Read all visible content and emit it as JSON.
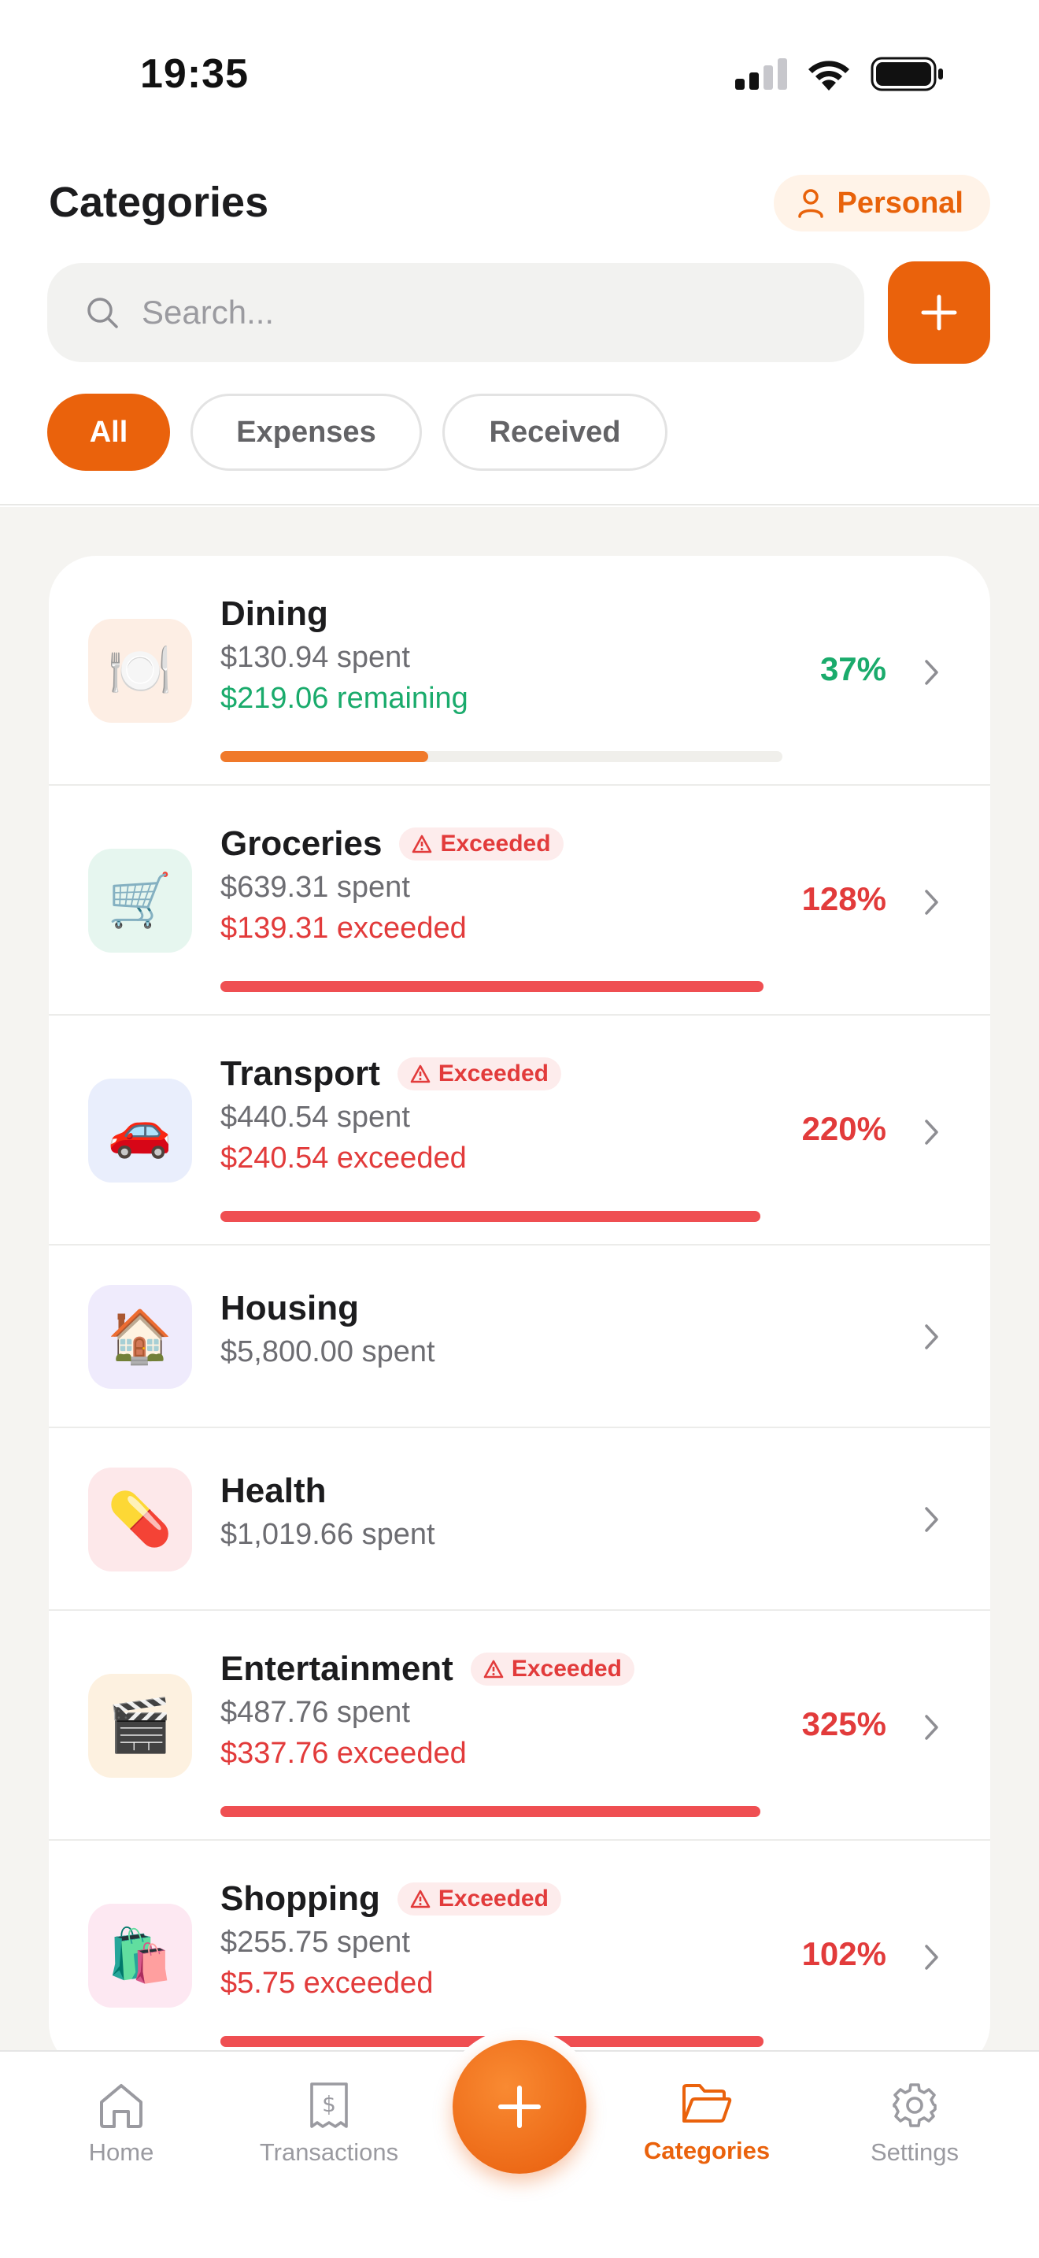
{
  "status_bar": {
    "time": "19:35"
  },
  "header": {
    "title": "Categories",
    "profile_label": "Personal",
    "search_placeholder": "Search...",
    "filters": [
      "All",
      "Expenses",
      "Received"
    ]
  },
  "categories": [
    {
      "name": "Dining",
      "emoji": "🍽️",
      "spent": "$130.94 spent",
      "status": "$219.06 remaining",
      "percent": "37%",
      "progress": 0.37,
      "exceeded": false,
      "icon_bg": "#fdeee4"
    },
    {
      "name": "Groceries",
      "emoji": "🛒",
      "spent": "$639.31 spent",
      "status": "$139.31 exceeded",
      "percent": "128%",
      "progress": 1.0,
      "exceeded": true,
      "badge": "Exceeded",
      "icon_bg": "#e6f6ef"
    },
    {
      "name": "Transport",
      "emoji": "🚗",
      "spent": "$440.54 spent",
      "status": "$240.54 exceeded",
      "percent": "220%",
      "progress": 1.0,
      "exceeded": true,
      "badge": "Exceeded",
      "icon_bg": "#e9eefc"
    },
    {
      "name": "Housing",
      "emoji": "🏠",
      "spent": "$5,800.00 spent",
      "icon_bg": "#efebfc"
    },
    {
      "name": "Health",
      "emoji": "💊",
      "spent": "$1,019.66 spent",
      "icon_bg": "#fde8ea"
    },
    {
      "name": "Entertainment",
      "emoji": "🎬",
      "spent": "$487.76 spent",
      "status": "$337.76 exceeded",
      "percent": "325%",
      "progress": 1.0,
      "exceeded": true,
      "badge": "Exceeded",
      "icon_bg": "#fdf1e0"
    },
    {
      "name": "Shopping",
      "emoji": "🛍️",
      "spent": "$255.75 spent",
      "status": "$5.75 exceeded",
      "percent": "102%",
      "progress": 1.0,
      "exceeded": true,
      "badge": "Exceeded",
      "icon_bg": "#fde8f2"
    }
  ],
  "tab_bar": {
    "home": "Home",
    "transactions": "Transactions",
    "categories": "Categories",
    "settings": "Settings"
  },
  "colors": {
    "accent": "#ea620c",
    "success": "#1aab6c",
    "danger": "#e23b3b"
  }
}
